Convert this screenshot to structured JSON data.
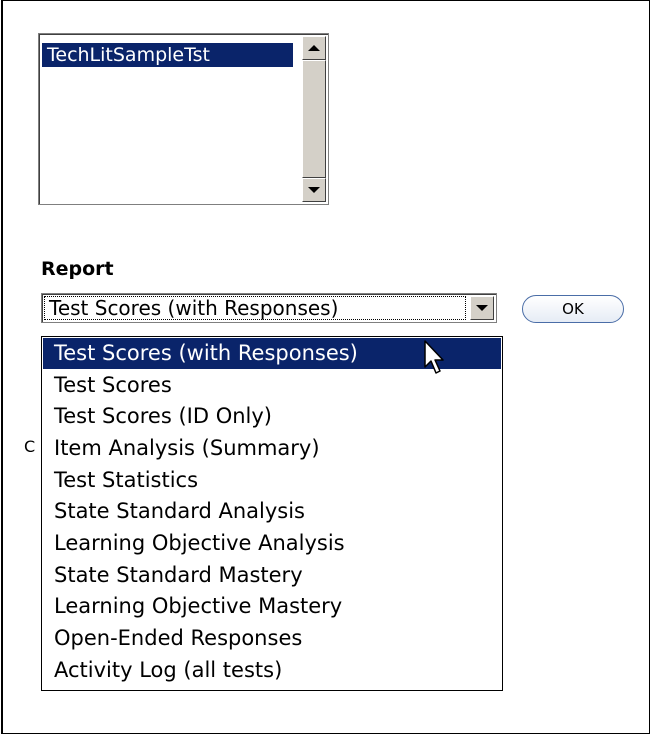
{
  "test_list": {
    "items": [
      "TechLitSampleTst"
    ],
    "selected_index": 0
  },
  "report": {
    "label": "Report",
    "selected_value": "Test Scores (with Responses)",
    "ok_label": "OK",
    "options": [
      "Test Scores (with Responses)",
      "Test Scores",
      "Test Scores (ID Only)",
      "Item Analysis (Summary)",
      "Test Statistics",
      "State Standard Analysis",
      "Learning Objective Analysis",
      "State Standard Mastery",
      "Learning Objective Mastery",
      "Open-Ended Responses",
      "Activity Log (all tests)"
    ],
    "highlighted_index": 0
  },
  "partial_text": "C",
  "colors": {
    "selection": "#0a246a",
    "button_face": "#d4d0c8",
    "ok_border": "#4a6da7"
  }
}
